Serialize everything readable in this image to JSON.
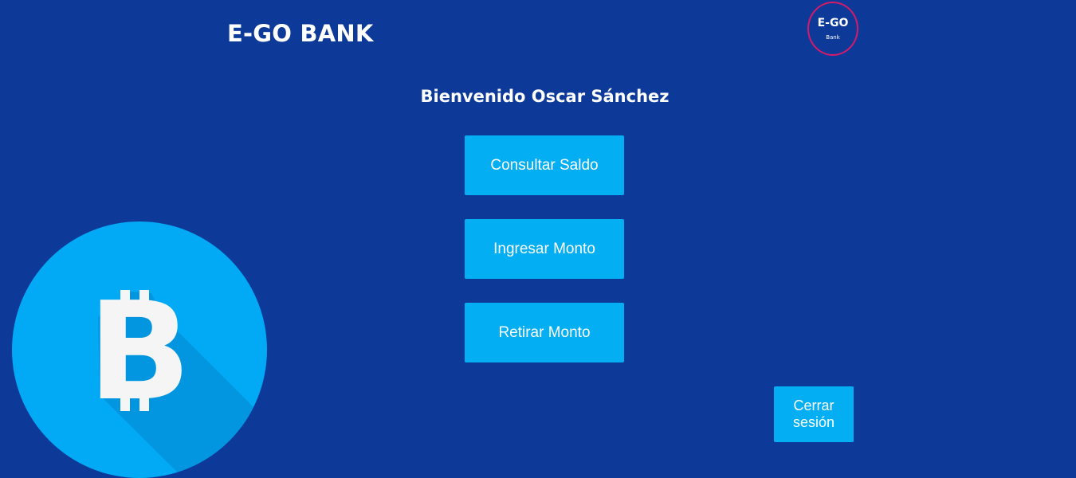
{
  "header": {
    "brand_title": "E-GO BANK",
    "logo": {
      "main_text": "E-GO",
      "sub_text": "Bank"
    }
  },
  "main": {
    "welcome": "Bienvenido Oscar Sánchez",
    "actions": {
      "balance_label": "Consultar Saldo",
      "deposit_label": "Ingresar Monto",
      "withdraw_label": "Retirar Monto"
    },
    "logout_label": "Cerrar sesión"
  },
  "illustration": {
    "icon": "bitcoin-icon",
    "glyph": "B"
  },
  "colors": {
    "background": "#0d3a99",
    "button": "#03aef3",
    "logo_ring": "#d61a6a",
    "bitcoin_circle": "#02a9f4",
    "bitcoin_shadow": "#0396e0",
    "text": "#ffffff"
  }
}
